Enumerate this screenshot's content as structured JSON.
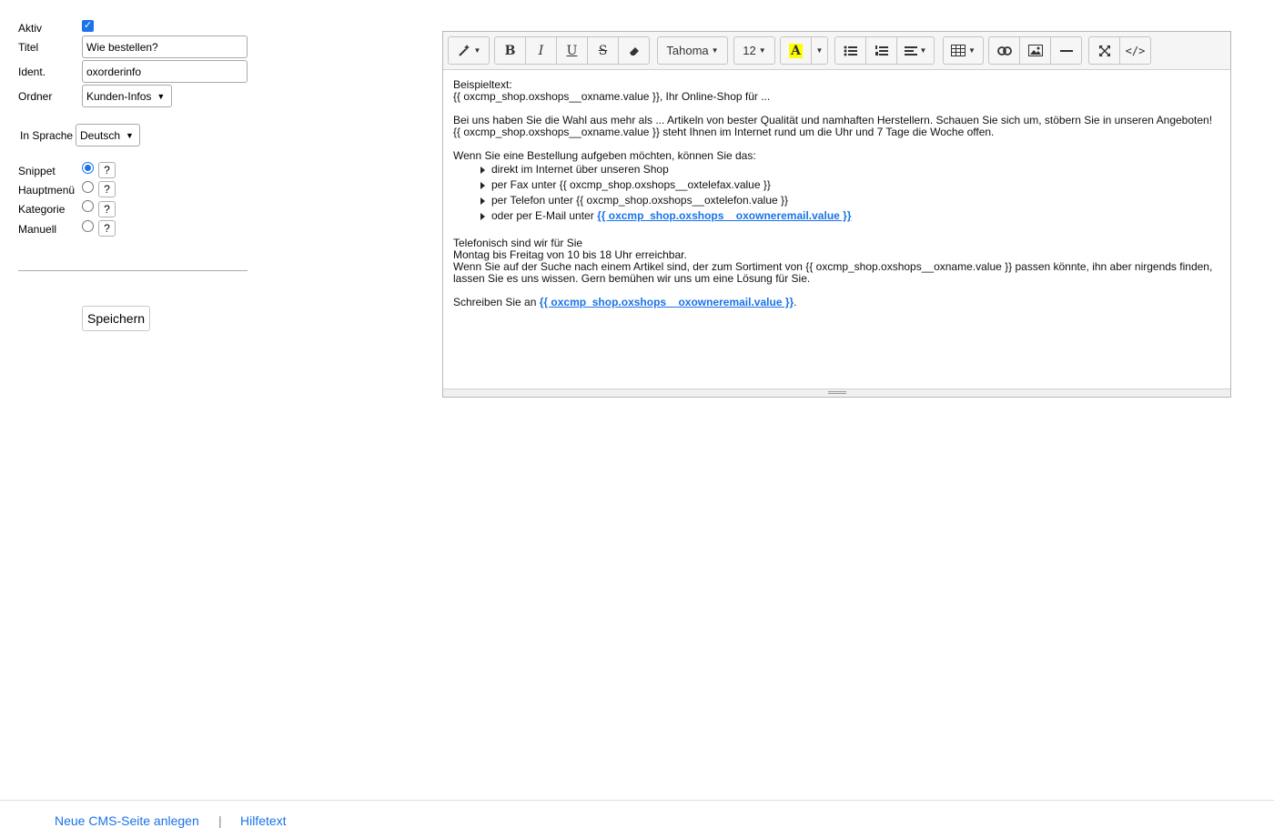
{
  "form": {
    "aktiv_label": "Aktiv",
    "aktiv_checked": true,
    "titel_label": "Titel",
    "titel_value": "Wie bestellen?",
    "ident_label": "Ident.",
    "ident_value": "oxorderinfo",
    "ordner_label": "Ordner",
    "ordner_value": "Kunden-Infos",
    "sprache_label": "In Sprache",
    "sprache_value": "Deutsch",
    "types": [
      {
        "label": "Snippet",
        "checked": true,
        "help": "?"
      },
      {
        "label": "Hauptmenü",
        "checked": false,
        "help": "?"
      },
      {
        "label": "Kategorie",
        "checked": false,
        "help": "?"
      },
      {
        "label": "Manuell",
        "checked": false,
        "help": "?"
      }
    ],
    "save_label": "Speichern"
  },
  "editor": {
    "font_name": "Tahoma",
    "font_size": "12",
    "highlight_letter": "A",
    "highlight_color": "#ffff00",
    "content": {
      "p1_line1": "Beispieltext:",
      "p1_line2": "{{ oxcmp_shop.oxshops__oxname.value }}, Ihr Online-Shop für ...",
      "p2_line1": "Bei uns haben Sie die Wahl aus mehr als ... Artikeln von bester Qualität und namhaften Herstellern. Schauen Sie sich um, stöbern Sie in unseren Angeboten!",
      "p2_line2": "{{ oxcmp_shop.oxshops__oxname.value }} steht Ihnen im Internet rund um die Uhr und 7 Tage die Woche offen.",
      "p3": "Wenn Sie eine Bestellung aufgeben möchten, können Sie das:",
      "list": [
        "direkt im Internet über unseren Shop",
        "per Fax unter {{ oxcmp_shop.oxshops__oxtelefax.value }}",
        "per Telefon unter {{ oxcmp_shop.oxshops__oxtelefon.value }}"
      ],
      "list_email_prefix": "oder per E-Mail unter ",
      "email_link": "{{ oxcmp_shop.oxshops__oxowneremail.value }}",
      "p4_line1": "Telefonisch sind wir für Sie",
      "p4_line2": "Montag bis Freitag von 10 bis 18 Uhr erreichbar.",
      "p4_line3": "Wenn Sie auf der Suche nach einem Artikel sind, der zum Sortiment von {{ oxcmp_shop.oxshops__oxname.value }} passen könnte, ihn aber nirgends finden, lassen Sie es uns wissen. Gern bemühen wir uns um eine Lösung für Sie.",
      "p5_prefix": "Schreiben Sie an ",
      "p5_suffix": "."
    }
  },
  "bottom": {
    "link1": "Neue CMS-Seite anlegen",
    "link2": "Hilfetext"
  }
}
